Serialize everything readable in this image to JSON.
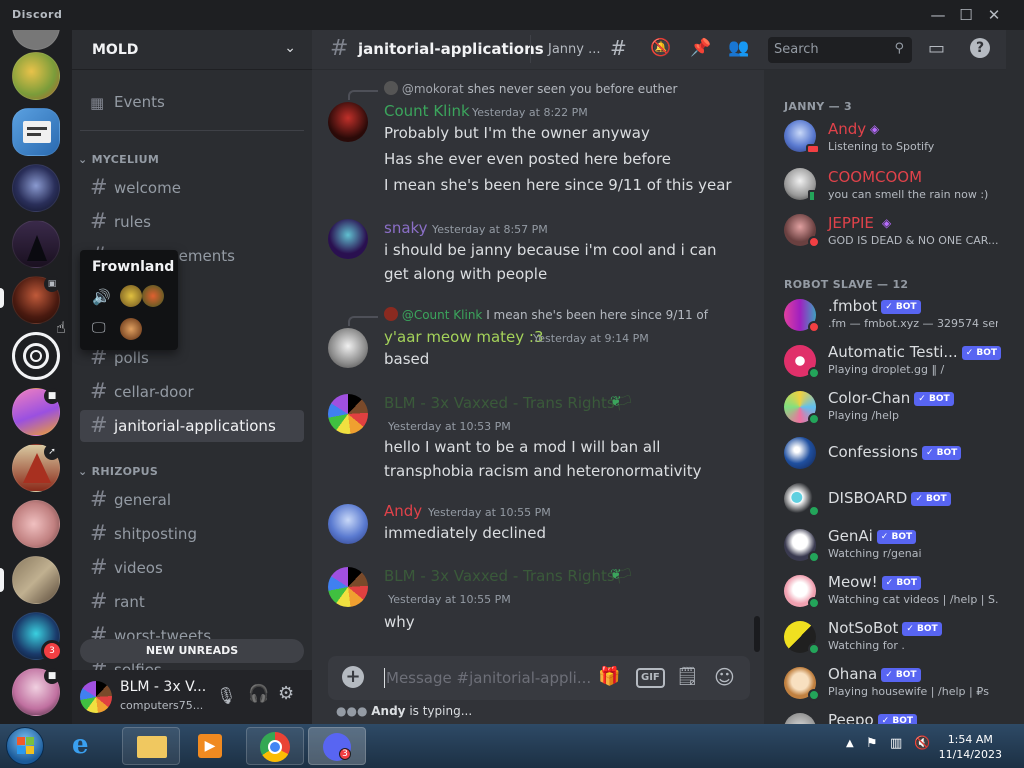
{
  "app": {
    "title": "Discord"
  },
  "window_controls": {
    "minimize": "—",
    "maximize": "☐",
    "close": "✕"
  },
  "server": {
    "name": "MOLD",
    "events_label": "Events"
  },
  "categories": [
    {
      "name": "MYCELIUM",
      "channels": [
        "welcome",
        "rules",
        "announcements",
        "polls",
        "cellar-door",
        "janitorial-applications"
      ]
    },
    {
      "name": "RHIZOPUS",
      "channels": [
        "general",
        "shitposting",
        "videos",
        "rant",
        "worst-tweets",
        "selfies"
      ]
    }
  ],
  "active_channel": "janitorial-applications",
  "new_unreads_label": "NEW UNREADS",
  "tooltip": {
    "server_name": "Frownland"
  },
  "guild_badges": {
    "mentions": "3"
  },
  "user_panel": {
    "name": "BLM - 3x V...",
    "status": "computers75..."
  },
  "header": {
    "channel": "janitorial-applications",
    "topic": "Janny ...",
    "search_placeholder": "Search"
  },
  "messages": [
    {
      "reply_to": "@mokorat",
      "reply_text": "shes never seen you before euther",
      "author": "Count Klink",
      "author_color": "#3ba55c",
      "time": "Yesterday at 8:22 PM",
      "lines": [
        "Probably but I'm the owner anyway",
        "Has she ever even posted here before",
        "I mean she's been here since 9/11 of this year"
      ]
    },
    {
      "author": "snaky",
      "author_color": "#8b6fc7",
      "time": "Yesterday at 8:57 PM",
      "lines": [
        "i should be janny because i'm cool and i can",
        "get along with people"
      ]
    },
    {
      "reply_to": "@Count Klink",
      "reply_text": "I mean she's been here since 9/11 of",
      "author": "y'aar meow matey :3",
      "author_color": "#a4d25a",
      "time": "Yesterday at 9:14 PM",
      "lines": [
        "based"
      ]
    },
    {
      "author": "BLM - 3x Vaxxed - Trans Rights🏳",
      "author_color": "#3a5a3a",
      "time": "Yesterday at 10:53 PM",
      "lines": [
        "hello I want to be a mod I will ban all",
        "transphobia racism and heteronormativity"
      ]
    },
    {
      "author": "Andy",
      "author_color": "#e0424a",
      "time": "Yesterday at 10:55 PM",
      "lines": [
        "immediately declined"
      ]
    },
    {
      "author": "BLM - 3x Vaxxed - Trans Rights🏳",
      "author_color": "#3a5a3a",
      "time": "Yesterday at 10:55 PM",
      "lines": [
        "why"
      ]
    }
  ],
  "composer": {
    "placeholder": "Message #janitorial-appli..."
  },
  "typing": {
    "user": "Andy",
    "text": "is typing..."
  },
  "member_sections": [
    {
      "title": "JANNY — 3",
      "members": [
        {
          "name": "Andy",
          "color": "#e0424a",
          "activity": "Listening to Spotify",
          "status": "mobile"
        },
        {
          "name": "COOMCOOM",
          "color": "#e0424a",
          "activity": "you can smell the rain now :)",
          "status": "mobile"
        },
        {
          "name": "JEPPIE",
          "color": "#e0424a",
          "activity": "GOD IS DEAD & NO ONE CAR...",
          "status": "dnd"
        }
      ]
    },
    {
      "title": "ROBOT SLAVE — 12",
      "members": [
        {
          "name": ".fmbot",
          "color": "#dbdee1",
          "activity": ".fm — fmbot.xyz — 329574 ser...",
          "bot": "✓ BOT",
          "status": "dnd"
        },
        {
          "name": "Automatic Testi...",
          "color": "#dbdee1",
          "activity": "Playing droplet.gg ‖ /",
          "bot": "✓ BOT",
          "status": "online"
        },
        {
          "name": "Color-Chan",
          "color": "#dbdee1",
          "activity": "Playing /help",
          "bot": "✓ BOT",
          "status": "online"
        },
        {
          "name": "Confessions",
          "color": "#dbdee1",
          "activity": "",
          "bot": "✓ BOT",
          "status": "online"
        },
        {
          "name": "DISBOARD",
          "color": "#dbdee1",
          "activity": "",
          "bot": "✓ BOT",
          "status": "online"
        },
        {
          "name": "GenAi",
          "color": "#dbdee1",
          "activity": "Watching r/genai",
          "bot": "✓ BOT",
          "status": "online"
        },
        {
          "name": "Meow!",
          "color": "#dbdee1",
          "activity": "Watching cat videos | /help | S...",
          "bot": "✓ BOT",
          "status": "online"
        },
        {
          "name": "NotSoBot",
          "color": "#dbdee1",
          "activity": "Watching for .",
          "bot": "✓ BOT",
          "status": "online"
        },
        {
          "name": "Ohana",
          "color": "#dbdee1",
          "activity": "Playing housewife | /help | ₽s",
          "bot": "✓ BOT",
          "status": "online"
        },
        {
          "name": "Peepo",
          "color": "#dbdee1",
          "activity": "",
          "bot": "✓ BOT",
          "status": "online"
        }
      ]
    }
  ],
  "taskbar": {
    "time": "1:54 AM",
    "date": "11/14/2023",
    "discord_badge": "3"
  }
}
